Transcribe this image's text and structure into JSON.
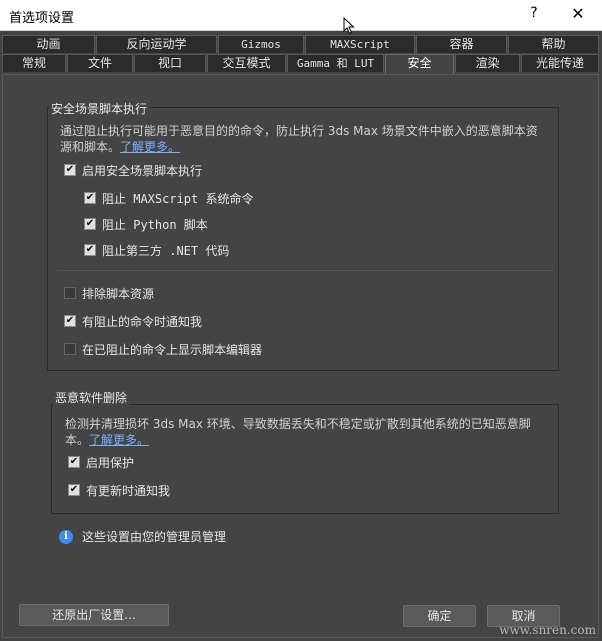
{
  "window": {
    "title": "首选项设置",
    "help_label": "?",
    "close_label": "✕"
  },
  "tabs": {
    "row1": [
      {
        "label": "动画"
      },
      {
        "label": "反向运动学"
      },
      {
        "label": "Gizmos"
      },
      {
        "label": "MAXScript"
      },
      {
        "label": "容器"
      },
      {
        "label": "帮助"
      }
    ],
    "row2": [
      {
        "label": "常规"
      },
      {
        "label": "文件"
      },
      {
        "label": "视口"
      },
      {
        "label": "交互模式"
      },
      {
        "label": "Gamma 和 LUT"
      },
      {
        "label": "安全"
      },
      {
        "label": "渲染"
      },
      {
        "label": "光能传递"
      }
    ]
  },
  "safe_scene": {
    "title": "安全场景脚本执行",
    "desc_line1": "通过阻止执行可能用于恶意目的的命令，防止执行 3ds Max 场景文件中嵌入的恶意脚本资",
    "desc_line2": "源和脚本。",
    "learn_more": "了解更多。",
    "enable_label": "启用安全场景脚本执行",
    "block_maxscript": "阻止 MAXScript 系统命令",
    "block_python": "阻止 Python 脚本",
    "block_net": "阻止第三方 .NET 代码",
    "exclude_label": "排除脚本资源",
    "notify_label": "有阻止的命令时通知我",
    "show_editor_label": "在已阻止的命令上显示脚本编辑器"
  },
  "malware": {
    "title": "恶意软件删除",
    "desc_line1": "检测并清理损坏 3ds Max 环境、导致数据丢失和不稳定或扩散到其他系统的已知恶意脚",
    "desc_line2": "本。",
    "learn_more": "了解更多。",
    "protect_label": "启用保护",
    "update_label": "有更新时通知我"
  },
  "admin_note": "这些设置由您的管理员管理",
  "buttons": {
    "reset": "还原出厂设置...",
    "ok": "确定",
    "cancel": "取消"
  },
  "watermark": "www.snren.com",
  "icons": {
    "check": "✔",
    "info": "i"
  },
  "colors": {
    "background": "#444444",
    "tab_bg": "#2b2b2b",
    "link": "#7fb0ff",
    "info_icon": "#3d8eea"
  }
}
